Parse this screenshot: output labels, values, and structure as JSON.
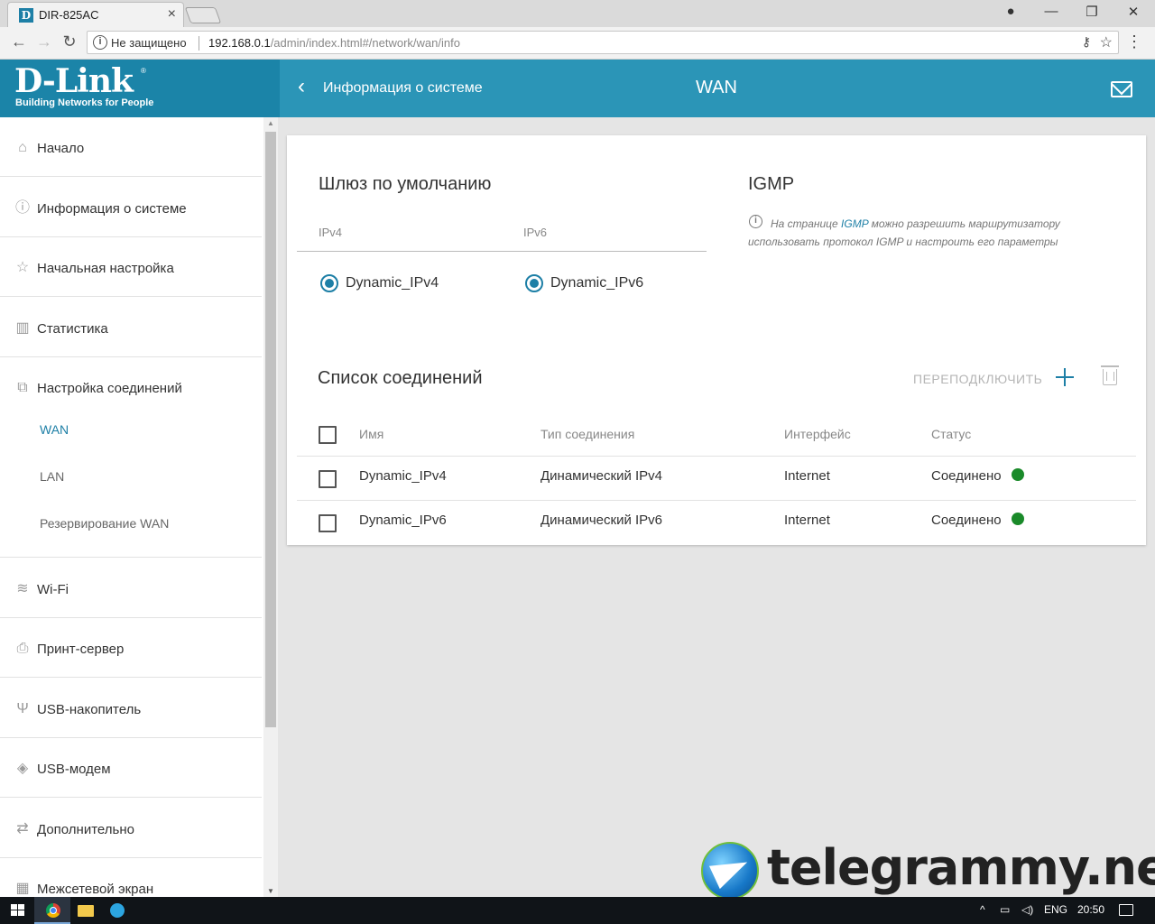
{
  "browser": {
    "tab_title": "DIR-825AC",
    "tab_close": "×",
    "security_label": "Не защищено",
    "url_host": "192.168.0.1",
    "url_path": "/admin/index.html#/network/wan/info",
    "window_controls": {
      "minimize": "—",
      "maximize": "❐",
      "close": "✕"
    },
    "nav": {
      "back": "←",
      "forward": "→",
      "reload": "↻"
    }
  },
  "header": {
    "logo": "D-Link",
    "logo_reg": "®",
    "logo_tagline": "Building Networks for People",
    "back_chevron": "‹",
    "back_label": "Информация о системе",
    "title": "WAN",
    "brand_color": "#2b95b7"
  },
  "sidebar": {
    "items": [
      {
        "label": "Начало",
        "icon": "home-icon",
        "glyph": "⌂"
      },
      {
        "label": "Информация о системе",
        "icon": "info-icon",
        "glyph": "ⓘ"
      },
      {
        "label": "Начальная настройка",
        "icon": "wizard-icon",
        "glyph": "☆"
      },
      {
        "label": "Статистика",
        "icon": "bar-chart-icon",
        "glyph": "▥"
      },
      {
        "label": "Настройка соединений",
        "icon": "connections-icon",
        "glyph": "⧉"
      },
      {
        "label": "Wi-Fi",
        "icon": "wifi-icon",
        "glyph": "≋"
      },
      {
        "label": "Принт-сервер",
        "icon": "printer-icon",
        "glyph": "⎙"
      },
      {
        "label": "USB-накопитель",
        "icon": "usb-icon",
        "glyph": "Ψ"
      },
      {
        "label": "USB-модем",
        "icon": "usb-modem-icon",
        "glyph": "◈"
      },
      {
        "label": "Дополнительно",
        "icon": "transfer-icon",
        "glyph": "⇄"
      },
      {
        "label": "Межсетевой экран",
        "icon": "firewall-icon",
        "glyph": "▦"
      }
    ],
    "subitems": [
      {
        "label": "WAN",
        "active": true
      },
      {
        "label": "LAN",
        "active": false
      },
      {
        "label": "Резервирование WAN",
        "active": false
      }
    ]
  },
  "gateway": {
    "title": "Шлюз по умолчанию",
    "ipv4_header": "IPv4",
    "ipv6_header": "IPv6",
    "ipv4_value": "Dynamic_IPv4",
    "ipv6_value": "Dynamic_IPv6"
  },
  "igmp": {
    "title": "IGMP",
    "info_prefix": "На странице ",
    "info_link": "IGMP",
    "info_suffix": " можно разрешить маршрутизатору использовать протокол IGMP и настроить его параметры"
  },
  "connections": {
    "title": "Список соединений",
    "reconnect_label": "ПЕРЕПОДКЛЮЧИТЬ",
    "columns": [
      "Имя",
      "Тип соединения",
      "Интерфейс",
      "Статус"
    ],
    "rows": [
      {
        "name": "Dynamic_IPv4",
        "type": "Динамический IPv4",
        "interface": "Internet",
        "status": "Соединено",
        "status_color": "#1a8a2a"
      },
      {
        "name": "Dynamic_IPv6",
        "type": "Динамический IPv6",
        "interface": "Internet",
        "status": "Соединено",
        "status_color": "#1a8a2a"
      }
    ]
  },
  "watermark": {
    "text": "telegrammy.net"
  },
  "taskbar": {
    "lang": "ENG",
    "time": "20:50",
    "tray_chevron": "^"
  }
}
